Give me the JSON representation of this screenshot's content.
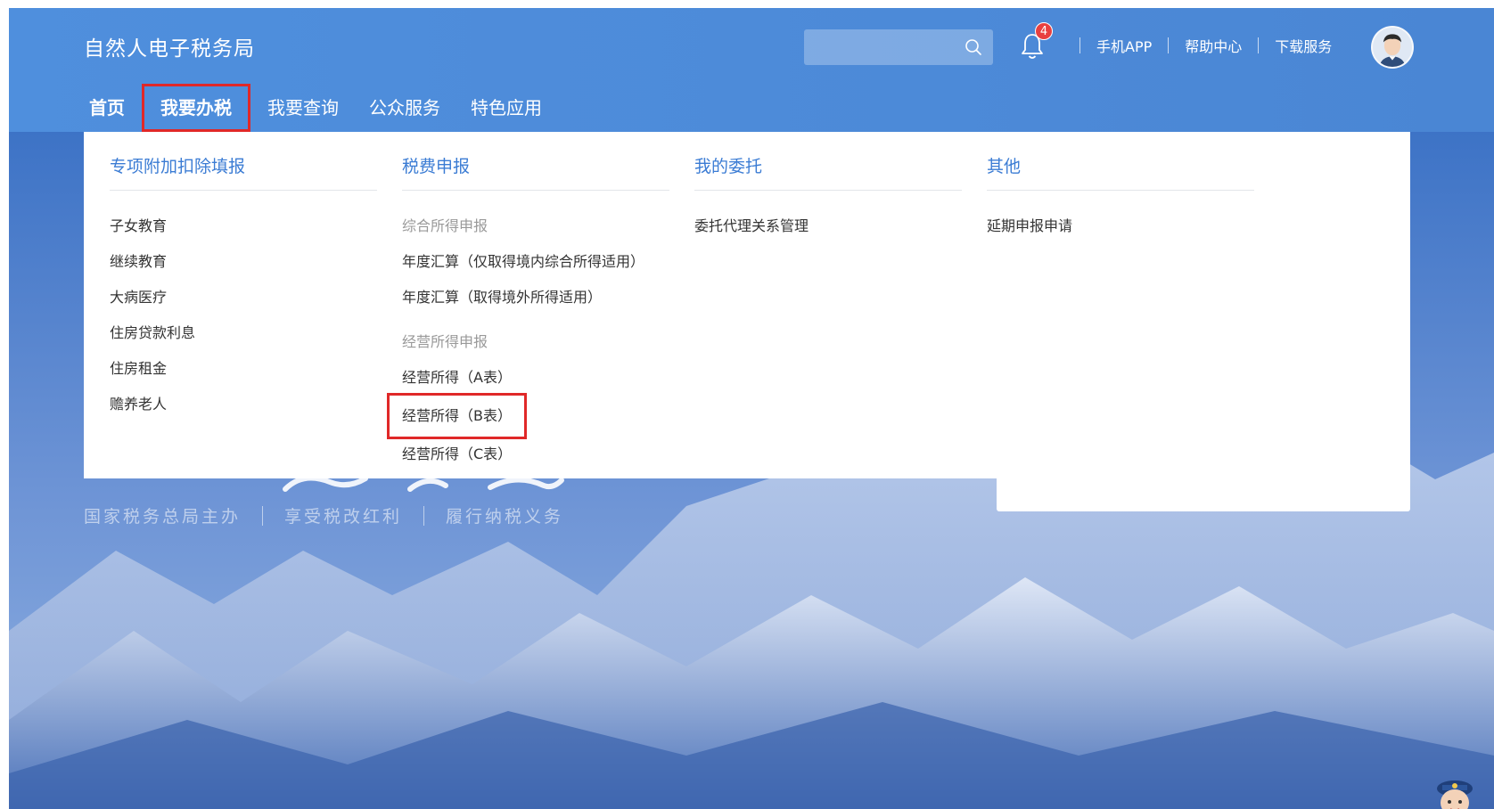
{
  "header": {
    "site_title": "自然人电子税务局",
    "search_placeholder": "",
    "notification_count": "4",
    "links": [
      "手机APP",
      "帮助中心",
      "下载服务"
    ]
  },
  "nav": {
    "items": [
      "首页",
      "我要办税",
      "我要查询",
      "公众服务",
      "特色应用"
    ]
  },
  "mega_menu": {
    "col1": {
      "header": "专项附加扣除填报",
      "items": [
        "子女教育",
        "继续教育",
        "大病医疗",
        "住房贷款利息",
        "住房租金",
        "赡养老人"
      ]
    },
    "col2": {
      "header": "税费申报",
      "sub1": "综合所得申报",
      "sub1_items": [
        "年度汇算（仅取得境内综合所得适用）",
        "年度汇算（取得境外所得适用）"
      ],
      "sub2": "经营所得申报",
      "sub2_items": [
        "经营所得（A表）",
        "经营所得（B表）",
        "经营所得（C表）"
      ]
    },
    "col3": {
      "header": "我的委托",
      "items": [
        "委托代理关系管理"
      ]
    },
    "col4": {
      "header": "其他",
      "items": [
        "延期申报申请"
      ]
    }
  },
  "slogan": [
    "国家税务总局主办",
    "享受税改红利",
    "履行纳税义务"
  ],
  "colors": {
    "header_bg": "#4d8bd9",
    "menu_header": "#3b7cd4",
    "highlight_border": "#e02828",
    "badge": "#e84040"
  }
}
